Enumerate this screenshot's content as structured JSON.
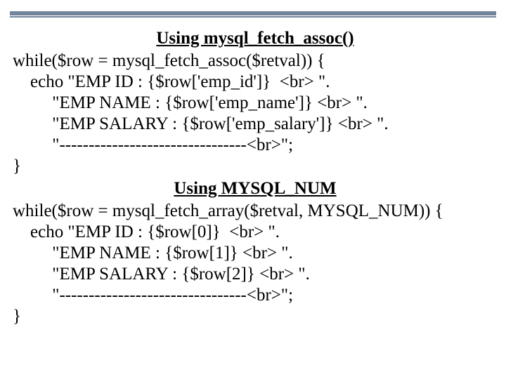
{
  "heading1": "Using mysql_fetch_assoc()",
  "block1": {
    "l1": "while($row = mysql_fetch_assoc($retval)) {",
    "l2": "    echo \"EMP ID : {$row['emp_id']}  <br> \".",
    "l3": "         \"EMP NAME : {$row['emp_name']} <br> \".",
    "l4": "         \"EMP SALARY : {$row['emp_salary']} <br> \".",
    "l5": "         \"--------------------------------<br>\";",
    "l6": "}"
  },
  "heading2": "Using MYSQL_NUM",
  "block2": {
    "l1": "while($row = mysql_fetch_array($retval, MYSQL_NUM)) {",
    "l2": "    echo \"EMP ID : {$row[0]}  <br> \".",
    "l3": "         \"EMP NAME : {$row[1]} <br> \".",
    "l4": "         \"EMP SALARY : {$row[2]} <br> \".",
    "l5": "         \"--------------------------------<br>\";",
    "l6": "}"
  }
}
